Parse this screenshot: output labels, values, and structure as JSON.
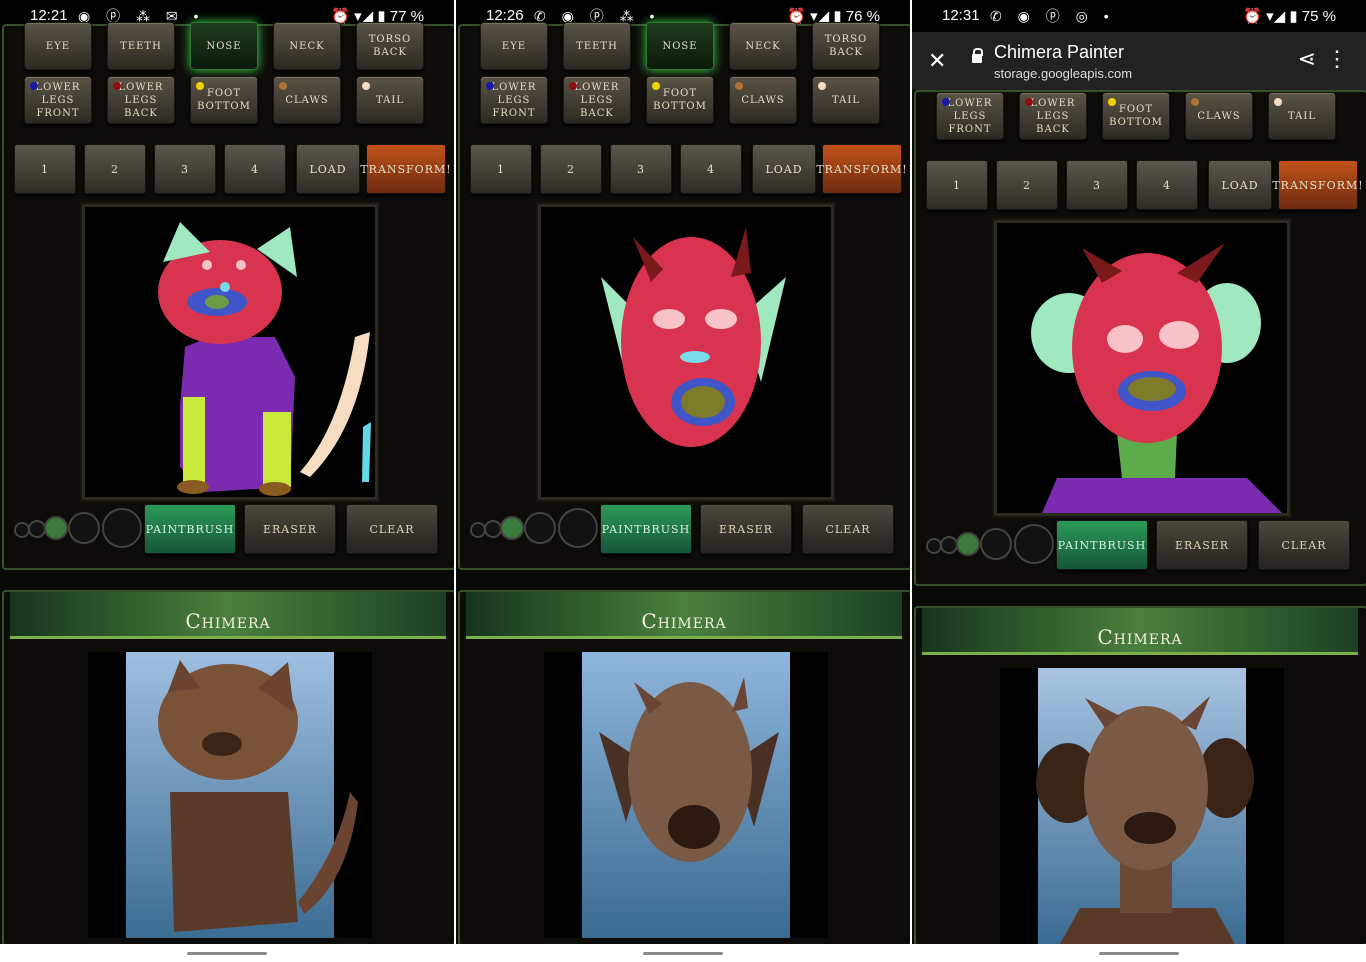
{
  "screens": [
    {
      "time": "12:21",
      "battery": "77 %"
    },
    {
      "time": "12:26",
      "battery": "76 %"
    },
    {
      "time": "12:31",
      "battery": "75 %"
    }
  ],
  "browser": {
    "title": "Chimera Painter",
    "url": "storage.googleapis.com"
  },
  "parts": {
    "eye": "Eye",
    "teeth": "Teeth",
    "nose": "Nose",
    "neck": "Neck",
    "torso_back": "Torso Back",
    "lower_legs_front": "Lower Legs Front",
    "lower_legs_back": "Lower Legs Back",
    "foot_bottom": "Foot Bottom",
    "claws": "Claws",
    "tail": "Tail"
  },
  "part_colors": {
    "lower_legs_front": "#1a1aa8",
    "lower_legs_back": "#8a1010",
    "foot_bottom": "#f0d000",
    "claws": "#b07030",
    "tail": "#f6dcc0"
  },
  "slots": [
    "1",
    "2",
    "3",
    "4"
  ],
  "load": "Load",
  "transform": "Transform!",
  "tools": {
    "paintbrush": "Paintbrush",
    "eraser": "Eraser",
    "clear": "Clear"
  },
  "chimera_title": "Chimera"
}
